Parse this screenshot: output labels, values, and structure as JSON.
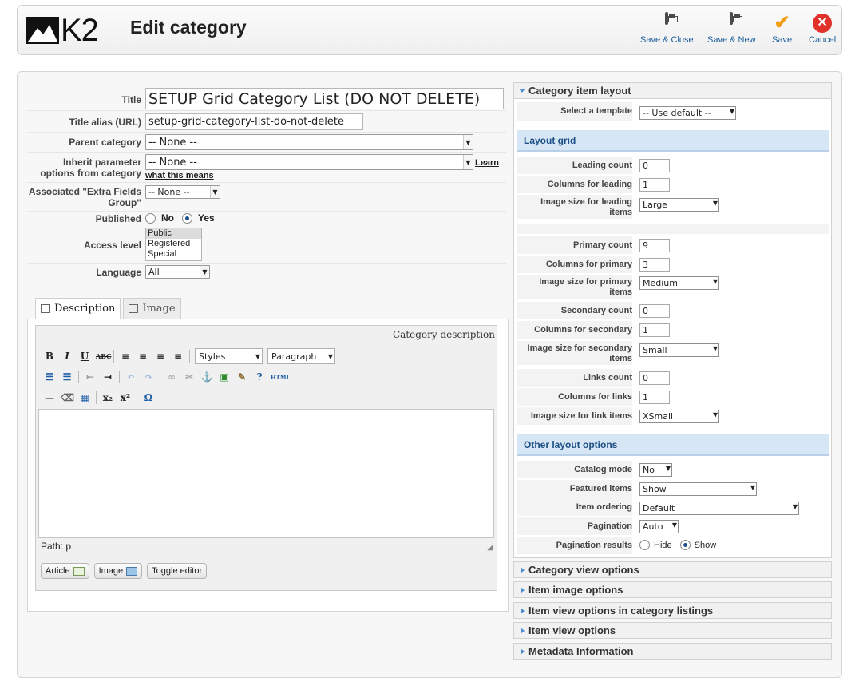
{
  "app": {
    "logo_text": "K2",
    "title": "Edit category"
  },
  "toolbar": {
    "save_close": "Save & Close",
    "save_new": "Save & New",
    "save": "Save",
    "cancel": "Cancel"
  },
  "form": {
    "title_label": "Title",
    "title_value": "SETUP Grid Category List (DO NOT DELETE)",
    "alias_label": "Title alias (URL)",
    "alias_value": "setup-grid-category-list-do-not-delete",
    "parent_label": "Parent category",
    "parent_value": "-- None --",
    "inherit_label": "Inherit parameter options from category",
    "inherit_value": "-- None --",
    "inherit_link_1": "Learn",
    "inherit_link_2": "what this means",
    "extra_label": "Associated \"Extra Fields Group\"",
    "extra_value": "-- None --",
    "published_label": "Published",
    "published_no": "No",
    "published_yes": "Yes",
    "access_label": "Access level",
    "access_options": [
      "Public",
      "Registered",
      "Special"
    ],
    "language_label": "Language",
    "language_value": "All"
  },
  "tabs": {
    "description": "Description",
    "image": "Image"
  },
  "editor": {
    "header": "Category description",
    "styles": "Styles",
    "paragraph": "Paragraph",
    "path": "Path: p",
    "btn_article": "Article",
    "btn_image": "Image",
    "btn_toggle": "Toggle editor"
  },
  "right": {
    "layout_header": "Category item layout",
    "template_label": "Select a template",
    "template_value": "-- Use default --",
    "layout_grid": "Layout grid",
    "leading_count_label": "Leading count",
    "leading_count": "0",
    "cols_leading_label": "Columns for leading",
    "cols_leading": "1",
    "img_leading_label": "Image size for leading items",
    "img_leading": "Large",
    "primary_count_label": "Primary count",
    "primary_count": "9",
    "cols_primary_label": "Columns for primary",
    "cols_primary": "3",
    "img_primary_label": "Image size for primary items",
    "img_primary": "Medium",
    "secondary_count_label": "Secondary count",
    "secondary_count": "0",
    "cols_secondary_label": "Columns for secondary",
    "cols_secondary": "1",
    "img_secondary_label": "Image size for secondary items",
    "img_secondary": "Small",
    "links_count_label": "Links count",
    "links_count": "0",
    "cols_links_label": "Columns for links",
    "cols_links": "1",
    "img_links_label": "Image size for link items",
    "img_links": "XSmall",
    "other_options": "Other layout options",
    "catalog_label": "Catalog mode",
    "catalog": "No",
    "featured_label": "Featured items",
    "featured": "Show",
    "ordering_label": "Item ordering",
    "ordering": "Default",
    "pagination_label": "Pagination",
    "pagination": "Auto",
    "pag_results_label": "Pagination results",
    "pag_hide": "Hide",
    "pag_show": "Show",
    "acc_category_view": "Category view options",
    "acc_item_image": "Item image options",
    "acc_item_view_listings": "Item view options in category listings",
    "acc_item_view": "Item view options",
    "acc_metadata": "Metadata Information"
  },
  "colors": {
    "link_blue": "#1a5d9a",
    "band": "#d7e6f5",
    "save_check": "#f39c12",
    "cancel_red": "#e0322a"
  }
}
